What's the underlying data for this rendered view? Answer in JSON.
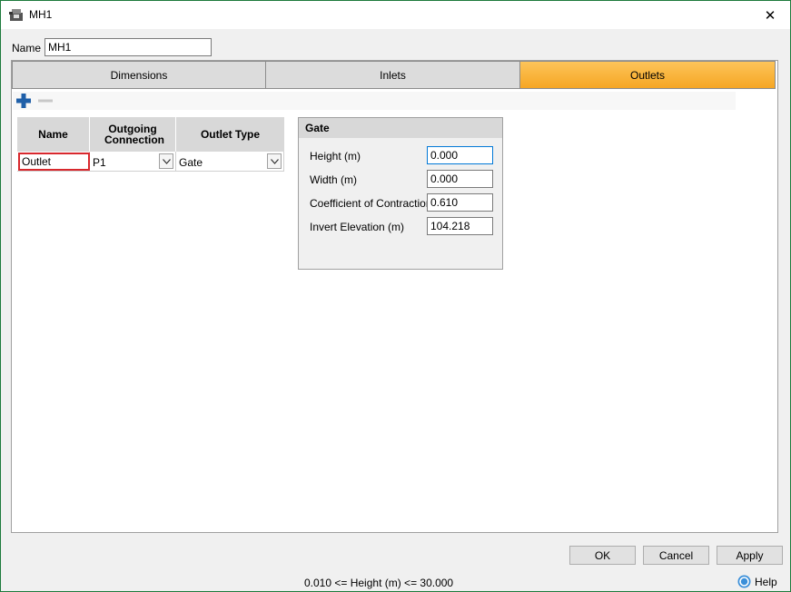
{
  "window": {
    "title": "MH1",
    "close_glyph": "✕"
  },
  "name_field": {
    "label": "Name",
    "value": "MH1"
  },
  "tabs": [
    {
      "label": "Dimensions",
      "active": false
    },
    {
      "label": "Inlets",
      "active": false
    },
    {
      "label": "Outlets",
      "active": true
    }
  ],
  "toolbar": {
    "add_icon": "plus-icon",
    "remove_icon": "minus-icon"
  },
  "outlets_grid": {
    "headers": [
      "Name",
      "Outgoing Connection",
      "Outlet Type"
    ],
    "rows": [
      {
        "name": "Outlet",
        "connection": "P1",
        "type": "Gate"
      }
    ]
  },
  "gate": {
    "title": "Gate",
    "fields": [
      {
        "label": "Height (m)",
        "value": "0.000"
      },
      {
        "label": "Width (m)",
        "value": "0.000"
      },
      {
        "label": "Coefficient of Contraction",
        "value": "0.610"
      },
      {
        "label": "Invert Elevation (m)",
        "value": "104.218"
      }
    ]
  },
  "buttons": {
    "ok": "OK",
    "cancel": "Cancel",
    "apply": "Apply"
  },
  "status_text": "0.010 <= Height (m) <= 30.000",
  "help_label": "Help",
  "colors": {
    "active_tab": "#f6a623",
    "accent_blue": "#1f5fa8",
    "edit_border": "#d8282d"
  }
}
